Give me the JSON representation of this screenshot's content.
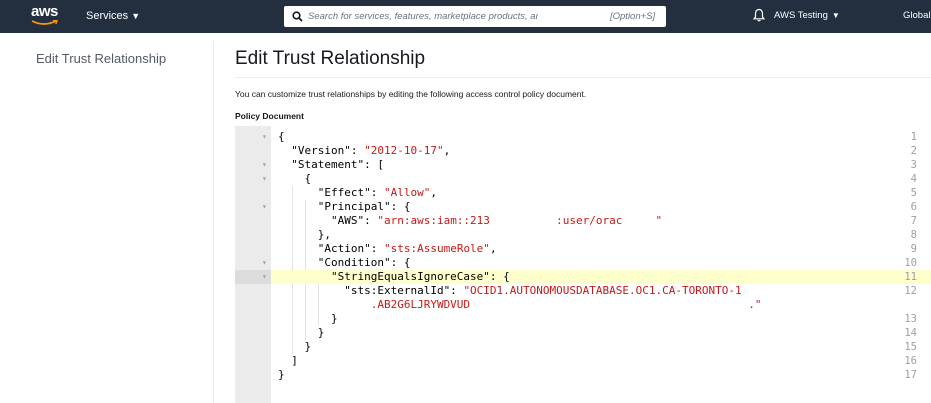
{
  "topnav": {
    "logo_text": "aws",
    "services_label": "Services",
    "search_placeholder": "Search for services, features, marketplace products, and docs",
    "search_shortcut": "[Option+S]",
    "account_label": "AWS Testing",
    "region_label": "Global",
    "colors": {
      "background": "#232f3e",
      "logo_smile": "#ff9900"
    }
  },
  "sidebar": {
    "link": "Edit Trust Relationship"
  },
  "main": {
    "title": "Edit Trust Relationship",
    "description": "You can customize trust relationships by editing the following access control policy document.",
    "doc_label": "Policy Document"
  },
  "editor": {
    "active_line": 11,
    "lines": [
      {
        "n": "1",
        "fold": true,
        "tokens": [
          {
            "t": "{"
          }
        ]
      },
      {
        "n": "2",
        "tokens": [
          {
            "t": "  \"Version\": "
          },
          {
            "t": "\"2012-10-17\"",
            "s": 1
          },
          {
            "t": ","
          }
        ]
      },
      {
        "n": "3",
        "fold": true,
        "tokens": [
          {
            "t": "  \"Statement\": ["
          }
        ]
      },
      {
        "n": "4",
        "fold": true,
        "tokens": [
          {
            "t": "    {"
          }
        ]
      },
      {
        "n": "5",
        "tokens": [
          {
            "t": "      \"Effect\": "
          },
          {
            "t": "\"Allow\"",
            "s": 1
          },
          {
            "t": ","
          }
        ]
      },
      {
        "n": "6",
        "fold": true,
        "tokens": [
          {
            "t": "      \"Principal\": {"
          }
        ]
      },
      {
        "n": "7",
        "tokens": [
          {
            "t": "        \"AWS\": "
          },
          {
            "t": "\"arn:aws:iam::213          :user/orac     \"",
            "s": 1
          }
        ]
      },
      {
        "n": "8",
        "tokens": [
          {
            "t": "      },"
          }
        ]
      },
      {
        "n": "9",
        "tokens": [
          {
            "t": "      \"Action\": "
          },
          {
            "t": "\"sts:AssumeRole\"",
            "s": 1
          },
          {
            "t": ","
          }
        ]
      },
      {
        "n": "10",
        "fold": true,
        "tokens": [
          {
            "t": "      \"Condition\": {"
          }
        ]
      },
      {
        "n": "11",
        "fold": true,
        "tokens": [
          {
            "t": "        \"StringEqualsIgnoreCase\": {"
          }
        ]
      },
      {
        "n": "12",
        "tokens": [
          {
            "t": "          \"sts:ExternalId\": "
          },
          {
            "t": "\"OCID1.AUTONOMOUSDATABASE.OC1.CA-TORONTO-1",
            "s": 1
          }
        ]
      },
      {
        "n": "",
        "tokens": [
          {
            "t": "              .AB2G6LJRYWDVUD                                          .\"",
            "s": 1
          }
        ]
      },
      {
        "n": "13",
        "tokens": [
          {
            "t": "        }"
          }
        ]
      },
      {
        "n": "14",
        "tokens": [
          {
            "t": "      }"
          }
        ]
      },
      {
        "n": "15",
        "tokens": [
          {
            "t": "    }"
          }
        ]
      },
      {
        "n": "16",
        "tokens": [
          {
            "t": "  ]"
          }
        ]
      },
      {
        "n": "17",
        "tokens": [
          {
            "t": "}"
          }
        ]
      }
    ]
  }
}
